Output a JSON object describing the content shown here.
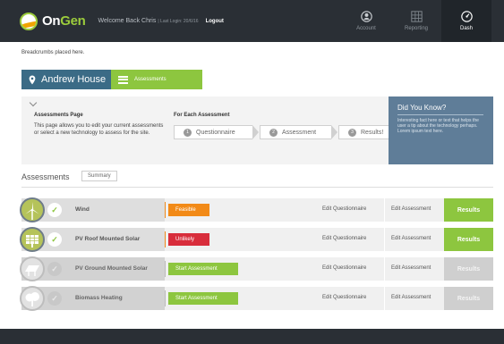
{
  "header": {
    "logo_on": "On",
    "logo_gen": "Gen",
    "welcome": "Welcome Back Chris",
    "last_login": "| Last Login: 20/6/16",
    "logout": "Logout",
    "nav": [
      {
        "label": "Account",
        "icon": "account-icon"
      },
      {
        "label": "Reporting",
        "icon": "reporting-icon"
      },
      {
        "label": "Dash",
        "icon": "dashboard-icon"
      }
    ]
  },
  "breadcrumbs": "Breadcrumbs placed here.",
  "project": {
    "name": "Andrew House",
    "tab": "Assessments"
  },
  "info": {
    "page_title": "Assessments Page",
    "page_desc": "This page allows you to edit your current assessments or select a  new technology to assess for the site.",
    "each_title": "For Each Assessment",
    "steps": [
      {
        "num": "1",
        "label": "Questionnaire"
      },
      {
        "num": "2",
        "label": "Assessment"
      },
      {
        "num": "3",
        "label": "Results!"
      }
    ]
  },
  "did_you_know": {
    "title": "Did You Know?",
    "text": "Interesting fact here or text that helps the user a tip about the technology perhaps. Lorem ipsum text here."
  },
  "assessments": {
    "heading": "Assessments",
    "summary_button": "Summary",
    "rows": [
      {
        "name": "Wind",
        "status": "Feasible",
        "status_type": "feasible",
        "edit_q": "Edit Questionnaire",
        "edit_a": "Edit Assessment",
        "results": "Results",
        "active": true
      },
      {
        "name": "PV Roof Mounted Solar",
        "status": "Unlikely",
        "status_type": "unlikely",
        "edit_q": "Edit Questionnaire",
        "edit_a": "Edit Assessment",
        "results": "Results",
        "active": true
      },
      {
        "name": "PV Ground Mounted Solar",
        "status": "Start Assessment",
        "status_type": "start",
        "edit_q": "Edit Questionnaire",
        "edit_a": "Edit Assessment",
        "results": "Results",
        "active": false
      },
      {
        "name": "Biomass Heating",
        "status": "Start Assessment",
        "status_type": "start",
        "edit_q": "Edit Questionnaire",
        "edit_a": "Edit Assessment",
        "results": "Results",
        "active": false
      }
    ]
  },
  "colors": {
    "header_bg": "#2a2f35",
    "brand_green": "#8dc63f",
    "project_blue": "#3b6b86",
    "feasible": "#f28a17",
    "unlikely": "#d82d3b",
    "info_panel": "#5f7d98"
  }
}
